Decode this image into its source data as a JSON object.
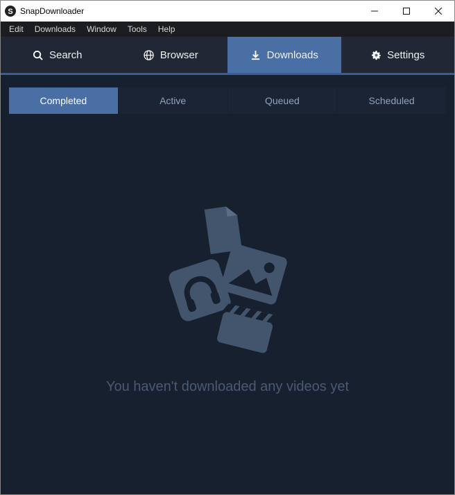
{
  "titlebar": {
    "title": "SnapDownloader"
  },
  "menu": {
    "items": [
      "Edit",
      "Downloads",
      "Window",
      "Tools",
      "Help"
    ]
  },
  "main_tabs": {
    "items": [
      {
        "label": "Search"
      },
      {
        "label": "Browser"
      },
      {
        "label": "Downloads"
      },
      {
        "label": "Settings"
      }
    ]
  },
  "sub_tabs": {
    "items": [
      "Completed",
      "Active",
      "Queued",
      "Scheduled"
    ]
  },
  "empty_state": {
    "message": "You haven't downloaded any videos yet"
  }
}
